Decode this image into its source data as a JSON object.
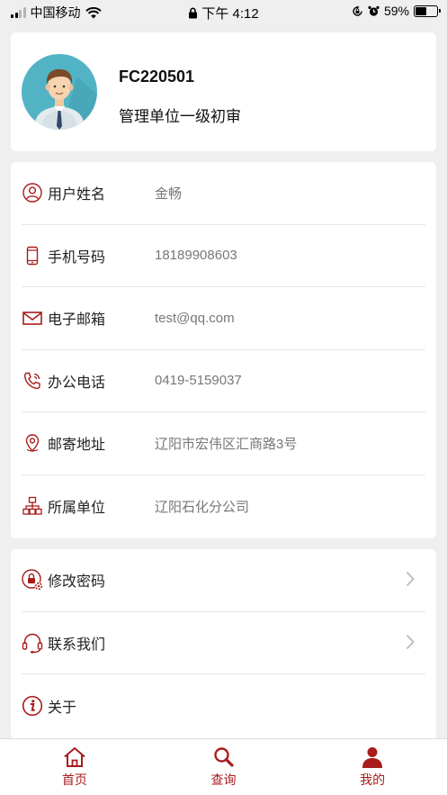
{
  "status_bar": {
    "carrier": "中国移动",
    "time": "下午 4:12",
    "battery_percent": "59%",
    "battery_level": 0.59
  },
  "profile": {
    "user_id": "FC220501",
    "role": "管理单位一级初审"
  },
  "info_rows": [
    {
      "label": "用户姓名",
      "value": "金畅",
      "icon": "user-icon"
    },
    {
      "label": "手机号码",
      "value": "18189908603",
      "icon": "phone-icon"
    },
    {
      "label": "电子邮箱",
      "value": "test@qq.com",
      "icon": "mail-icon"
    },
    {
      "label": "办公电话",
      "value": "0419-5159037",
      "icon": "telephone-icon"
    },
    {
      "label": "邮寄地址",
      "value": "辽阳市宏伟区汇商路3号",
      "icon": "location-icon"
    },
    {
      "label": "所属单位",
      "value": "辽阳石化分公司",
      "icon": "organization-icon"
    }
  ],
  "menu": [
    {
      "label": "修改密码",
      "icon": "lock-settings-icon"
    },
    {
      "label": "联系我们",
      "icon": "headset-icon"
    },
    {
      "label": "关于",
      "icon": "info-icon"
    }
  ],
  "tabs": [
    {
      "label": "首页",
      "icon": "home-icon"
    },
    {
      "label": "查询",
      "icon": "search-icon"
    },
    {
      "label": "我的",
      "icon": "person-icon",
      "active": true
    }
  ],
  "colors": {
    "accent": "#a81c1c",
    "background": "#efefef",
    "avatar_bg": "#52b3c5"
  }
}
